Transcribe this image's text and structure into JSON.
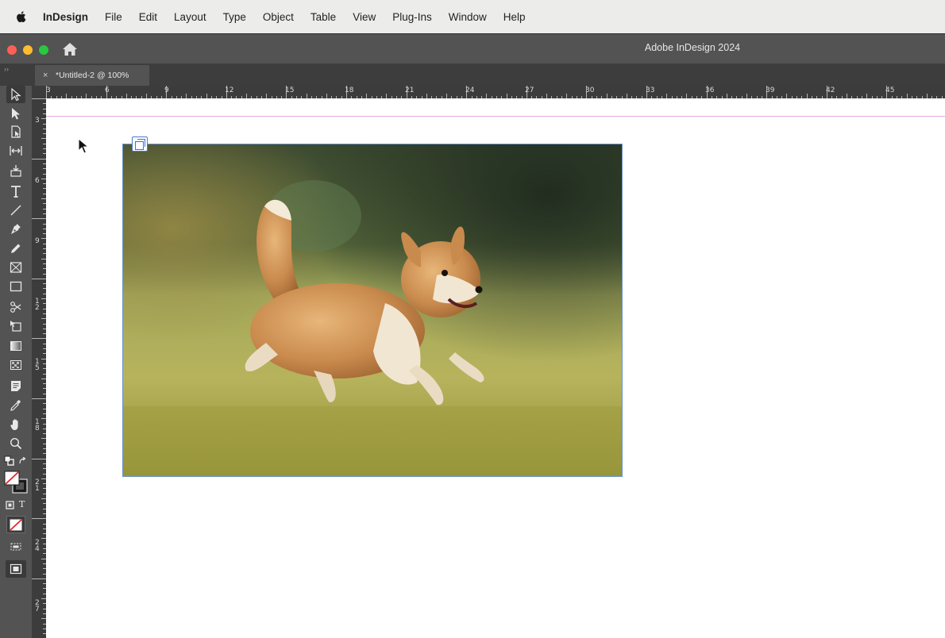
{
  "menubar": {
    "app": "InDesign",
    "items": [
      "File",
      "Edit",
      "Layout",
      "Type",
      "Object",
      "Table",
      "View",
      "Plug-Ins",
      "Window",
      "Help"
    ]
  },
  "window": {
    "title": "Adobe InDesign 2024"
  },
  "document_tab": {
    "label": "*Untitled-2 @ 100%",
    "close": "×"
  },
  "panel_grip": "››",
  "ruler": {
    "horizontal": [
      "3",
      "6",
      "9",
      "12",
      "15",
      "18",
      "21",
      "24",
      "27",
      "30",
      "33",
      "36",
      "39",
      "42",
      "45"
    ],
    "vertical": [
      "3",
      "6",
      "9",
      "1\n2",
      "1\n5",
      "1\n8",
      "2\n1",
      "2\n4",
      "2\n7"
    ]
  },
  "tools": [
    {
      "name": "selection-tool",
      "icon": "selection-arrow-icon",
      "selected": true
    },
    {
      "name": "direct-selection-tool",
      "icon": "direct-selection-arrow-icon"
    },
    {
      "name": "page-tool",
      "icon": "page-icon"
    },
    {
      "name": "gap-tool",
      "icon": "gap-icon"
    },
    {
      "name": "content-collector-tool",
      "icon": "content-collector-icon"
    },
    {
      "name": "type-tool",
      "icon": "type-icon"
    },
    {
      "name": "line-tool",
      "icon": "line-icon"
    },
    {
      "name": "pen-tool",
      "icon": "pen-icon"
    },
    {
      "name": "pencil-tool",
      "icon": "pencil-icon"
    },
    {
      "name": "rectangle-frame-tool",
      "icon": "rectangle-frame-icon"
    },
    {
      "name": "rectangle-tool",
      "icon": "rectangle-icon"
    },
    {
      "name": "scissors-tool",
      "icon": "scissors-icon"
    },
    {
      "name": "free-transform-tool",
      "icon": "free-transform-icon"
    },
    {
      "name": "gradient-swatch-tool",
      "icon": "gradient-icon"
    },
    {
      "name": "gradient-feather-tool",
      "icon": "gradient-feather-icon"
    },
    {
      "name": "note-tool",
      "icon": "note-icon"
    },
    {
      "name": "eyedropper-tool",
      "icon": "eyedropper-icon"
    },
    {
      "name": "hand-tool",
      "icon": "hand-icon"
    },
    {
      "name": "zoom-tool",
      "icon": "zoom-icon"
    }
  ],
  "format_labels": {
    "text": "T"
  },
  "colors": {
    "accent": "#4b7bd2",
    "guide": "#e6a9e6",
    "panel": "#535353"
  }
}
